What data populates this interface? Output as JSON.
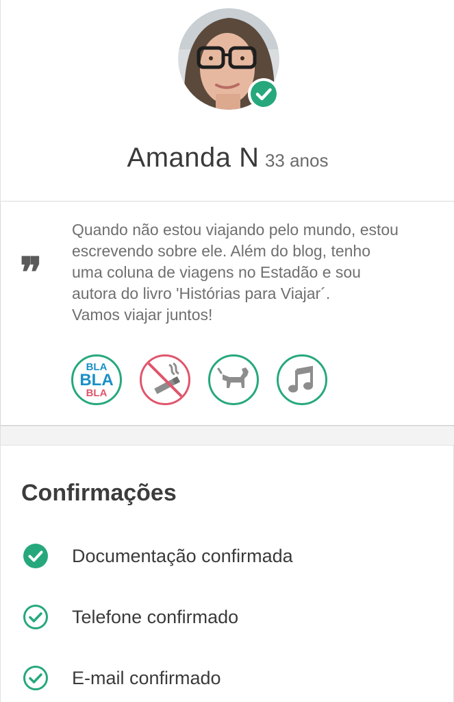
{
  "profile": {
    "name": "Amanda N",
    "age": "33 anos",
    "verified": true
  },
  "bio": {
    "lines": [
      "Quando não estou viajando pelo mundo, estou",
      "escrevendo sobre ele. Além do blog, tenho",
      "uma coluna de viagens no Estadão e sou",
      "autora do livro 'Histórias para Viajar´.",
      "Vamos viajar juntos!"
    ]
  },
  "preferences": {
    "chat_badge": {
      "line1": "BLA",
      "line2": "BLA",
      "line3": "BLA"
    },
    "icons": [
      "blabla-chatty-icon",
      "no-smoking-icon",
      "pets-allowed-icon",
      "music-icon"
    ]
  },
  "confirmations": {
    "title": "Confirmações",
    "items": [
      {
        "label": "Documentação confirmada",
        "icon": "check-filled-icon"
      },
      {
        "label": "Telefone confirmado",
        "icon": "check-outline-icon"
      },
      {
        "label": "E-mail confirmado",
        "icon": "check-outline-icon"
      }
    ]
  },
  "colors": {
    "accent_green": "#26a87c",
    "no_red": "#e0556b",
    "bla_blue": "#1a8fc7"
  }
}
